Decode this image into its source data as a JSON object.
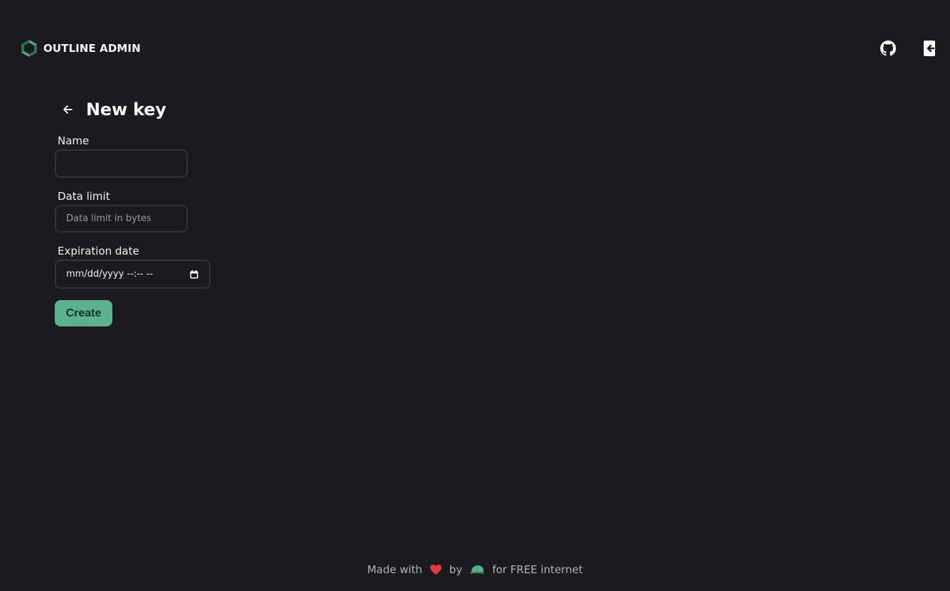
{
  "header": {
    "title": "OUTLINE ADMIN",
    "logo_icon": "outline-hexagon-logo",
    "github_icon": "github-icon",
    "logout_icon": "logout-icon"
  },
  "page": {
    "title": "New key",
    "back_icon": "arrow-left-icon"
  },
  "form": {
    "name": {
      "label": "Name",
      "value": "",
      "placeholder": ""
    },
    "data_limit": {
      "label": "Data limit",
      "value": "",
      "placeholder": "Data limit in bytes"
    },
    "expiration": {
      "label": "Expiration date",
      "value": "mm/dd/yyyy --:-- --",
      "icon": "calendar-icon"
    },
    "submit_label": "Create"
  },
  "footer": {
    "made_with": "Made with",
    "by": "by",
    "tagline": "for FREE internet",
    "heart_icon": "heart-icon",
    "author_icon": "cap-icon"
  },
  "colors": {
    "background": "#1b1a1f",
    "accent": "#5cb28e",
    "heart": "#e23b3b"
  }
}
